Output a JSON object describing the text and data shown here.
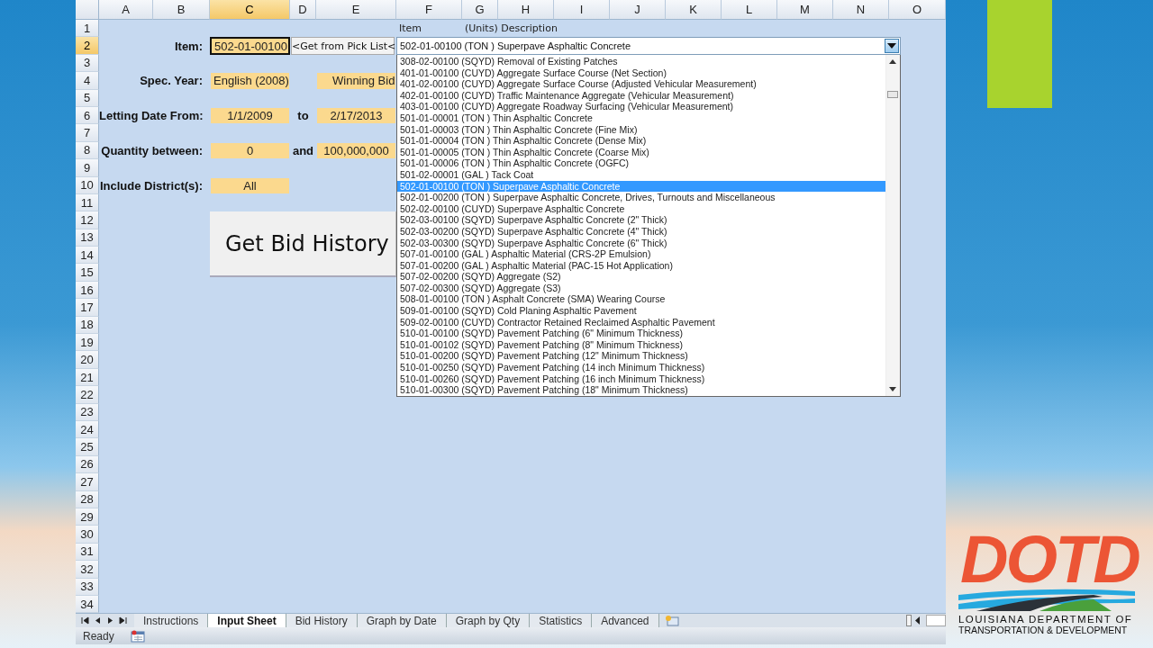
{
  "column_headers": [
    {
      "label": "A",
      "selected": false
    },
    {
      "label": "B",
      "selected": false
    },
    {
      "label": "C",
      "selected": true
    },
    {
      "label": "D",
      "selected": false
    },
    {
      "label": "E",
      "selected": false
    },
    {
      "label": "F",
      "selected": false
    },
    {
      "label": "G",
      "selected": false
    },
    {
      "label": "H",
      "selected": false
    },
    {
      "label": "I",
      "selected": false
    },
    {
      "label": "J",
      "selected": false
    },
    {
      "label": "K",
      "selected": false
    },
    {
      "label": "L",
      "selected": false
    },
    {
      "label": "M",
      "selected": false
    },
    {
      "label": "N",
      "selected": false
    },
    {
      "label": "O",
      "selected": false
    }
  ],
  "row_headers": [
    {
      "label": "1",
      "selected": false
    },
    {
      "label": "2",
      "selected": true
    },
    {
      "label": "3",
      "selected": false
    },
    {
      "label": "4",
      "selected": false
    },
    {
      "label": "5",
      "selected": false
    },
    {
      "label": "6",
      "selected": false
    },
    {
      "label": "7",
      "selected": false
    },
    {
      "label": "8",
      "selected": false
    },
    {
      "label": "9",
      "selected": false
    },
    {
      "label": "10",
      "selected": false
    },
    {
      "label": "11",
      "selected": false
    },
    {
      "label": "12",
      "selected": false
    },
    {
      "label": "13",
      "selected": false
    },
    {
      "label": "14",
      "selected": false
    },
    {
      "label": "15",
      "selected": false
    },
    {
      "label": "16",
      "selected": false
    },
    {
      "label": "17",
      "selected": false
    },
    {
      "label": "18",
      "selected": false
    },
    {
      "label": "19",
      "selected": false
    },
    {
      "label": "20",
      "selected": false
    },
    {
      "label": "21",
      "selected": false
    },
    {
      "label": "22",
      "selected": false
    },
    {
      "label": "23",
      "selected": false
    },
    {
      "label": "24",
      "selected": false
    },
    {
      "label": "25",
      "selected": false
    },
    {
      "label": "26",
      "selected": false
    },
    {
      "label": "27",
      "selected": false
    },
    {
      "label": "28",
      "selected": false
    },
    {
      "label": "29",
      "selected": false
    },
    {
      "label": "30",
      "selected": false
    },
    {
      "label": "31",
      "selected": false
    },
    {
      "label": "32",
      "selected": false
    },
    {
      "label": "33",
      "selected": false
    },
    {
      "label": "34",
      "selected": false
    }
  ],
  "list_headers": [
    "Item",
    "(Units) Description"
  ],
  "form_rows": [
    {
      "label": "Item:",
      "value": "502-01-00100",
      "selected": true,
      "kind": "text"
    },
    {
      "label": "Spec. Year:",
      "value": "English (2008)",
      "selected": false,
      "kind": "text",
      "value_2": "Winning Bid"
    },
    {
      "label": "Letting Date From:",
      "value": "1/1/2009",
      "selected": false,
      "kind": "range",
      "connector": "to",
      "value_2": "2/17/2013"
    },
    {
      "label": "Quantity between:",
      "value": "0",
      "selected": false,
      "kind": "range",
      "connector": "and",
      "value_2": "100,000,000"
    },
    {
      "label": "Include District(s):",
      "value": "All",
      "selected": false,
      "kind": "range"
    }
  ],
  "pick_list_button": "<Get from Pick List<",
  "action_button": "Get Bid History",
  "item_combo": {
    "value": "502-01-00100 (TON ) Superpave Asphaltic Concrete"
  },
  "item_list": [
    {
      "label": "308-02-00100 (SQYD) Removal of Existing Patches",
      "selected": false
    },
    {
      "label": "401-01-00100 (CUYD) Aggregate Surface Course (Net Section)",
      "selected": false
    },
    {
      "label": "401-02-00100 (CUYD) Aggregate Surface Course (Adjusted Vehicular Measurement)",
      "selected": false
    },
    {
      "label": "402-01-00100 (CUYD) Traffic Maintenance Aggregate (Vehicular Measurement)",
      "selected": false
    },
    {
      "label": "403-01-00100 (CUYD) Aggregate Roadway Surfacing (Vehicular Measurement)",
      "selected": false
    },
    {
      "label": "501-01-00001 (TON ) Thin Asphaltic Concrete",
      "selected": false
    },
    {
      "label": "501-01-00003 (TON ) Thin Asphaltic Concrete (Fine Mix)",
      "selected": false
    },
    {
      "label": "501-01-00004 (TON ) Thin Asphaltic Concrete (Dense Mix)",
      "selected": false
    },
    {
      "label": "501-01-00005 (TON ) Thin Asphaltic Concrete (Coarse Mix)",
      "selected": false
    },
    {
      "label": "501-01-00006 (TON ) Thin Asphaltic Concrete (OGFC)",
      "selected": false
    },
    {
      "label": "501-02-00001 (GAL ) Tack Coat",
      "selected": false
    },
    {
      "label": "502-01-00100 (TON ) Superpave Asphaltic Concrete",
      "selected": true
    },
    {
      "label": "502-01-00200 (TON ) Superpave Asphaltic Concrete, Drives, Turnouts and Miscellaneous",
      "selected": false
    },
    {
      "label": "502-02-00100 (CUYD) Superpave Asphaltic Concrete",
      "selected": false
    },
    {
      "label": "502-03-00100 (SQYD) Superpave Asphaltic Concrete (2\" Thick)",
      "selected": false
    },
    {
      "label": "502-03-00200 (SQYD) Superpave Asphaltic Concrete (4\" Thick)",
      "selected": false
    },
    {
      "label": "502-03-00300 (SQYD) Superpave Asphaltic Concrete (6\" Thick)",
      "selected": false
    },
    {
      "label": "507-01-00100 (GAL ) Asphaltic Material (CRS-2P Emulsion)",
      "selected": false
    },
    {
      "label": "507-01-00200 (GAL ) Asphaltic Material (PAC-15 Hot Application)",
      "selected": false
    },
    {
      "label": "507-02-00200 (SQYD) Aggregate (S2)",
      "selected": false
    },
    {
      "label": "507-02-00300 (SQYD) Aggregate (S3)",
      "selected": false
    },
    {
      "label": "508-01-00100 (TON ) Asphalt Concrete (SMA) Wearing Course",
      "selected": false
    },
    {
      "label": "509-01-00100 (SQYD) Cold Planing Asphaltic Pavement",
      "selected": false
    },
    {
      "label": "509-02-00100 (CUYD) Contractor Retained Reclaimed Asphaltic Pavement",
      "selected": false
    },
    {
      "label": "510-01-00100 (SQYD) Pavement Patching (6\" Minimum Thickness)",
      "selected": false
    },
    {
      "label": "510-01-00102 (SQYD) Pavement Patching (8\" Minimum Thickness)",
      "selected": false
    },
    {
      "label": "510-01-00200 (SQYD) Pavement Patching (12\" Minimum Thickness)",
      "selected": false
    },
    {
      "label": "510-01-00250 (SQYD) Pavement Patching (14 inch Minimum Thickness)",
      "selected": false
    },
    {
      "label": "510-01-00260 (SQYD) Pavement Patching (16 inch Minimum Thickness)",
      "selected": false
    },
    {
      "label": "510-01-00300 (SQYD) Pavement Patching (18\" Minimum Thickness)",
      "selected": false
    }
  ],
  "sheet_tabs": [
    {
      "label": "Instructions",
      "selected": false
    },
    {
      "label": "Input Sheet",
      "selected": true
    },
    {
      "label": "Bid History",
      "selected": false
    },
    {
      "label": "Graph by Date",
      "selected": false
    },
    {
      "label": "Graph by Qty",
      "selected": false
    },
    {
      "label": "Statistics",
      "selected": false
    },
    {
      "label": "Advanced",
      "selected": false
    }
  ],
  "status_bar": {
    "text": "Ready"
  },
  "logo": {
    "wordmark": "DOTD",
    "lines": [
      "LOUISIANA DEPARTMENT OF",
      "TRANSPORTATION & DEVELOPMENT"
    ]
  }
}
